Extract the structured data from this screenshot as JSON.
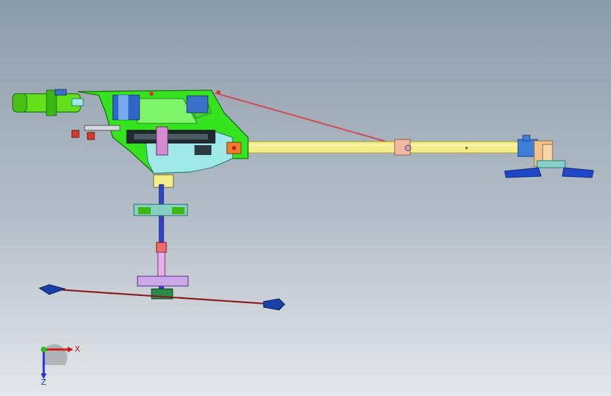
{
  "view": {
    "background_top": "#8d9caa",
    "background_bottom": "#e4e7eb"
  },
  "model_colors": {
    "frame": "#35e31f",
    "frame_edge": "#1a6e10",
    "servo_box": "#62e01a",
    "plate": "#9ee8e8",
    "tail_boom": "#f3ee8a",
    "tail_boom_edge": "#a69d2c",
    "push_rod": "#d87a88",
    "main_shaft": "#3344cc",
    "rotor_rod": "#8a1a1a",
    "blade_tip": "#1a3fa8",
    "tail_blades": "#2046c8",
    "tail_hub": "#f2c38a",
    "accent_orange": "#f08030"
  },
  "triad": {
    "x_label": "X",
    "z_label": "Z",
    "x_color": "#d41a1a",
    "y_color": "#20c020",
    "z_color": "#2030d0"
  }
}
